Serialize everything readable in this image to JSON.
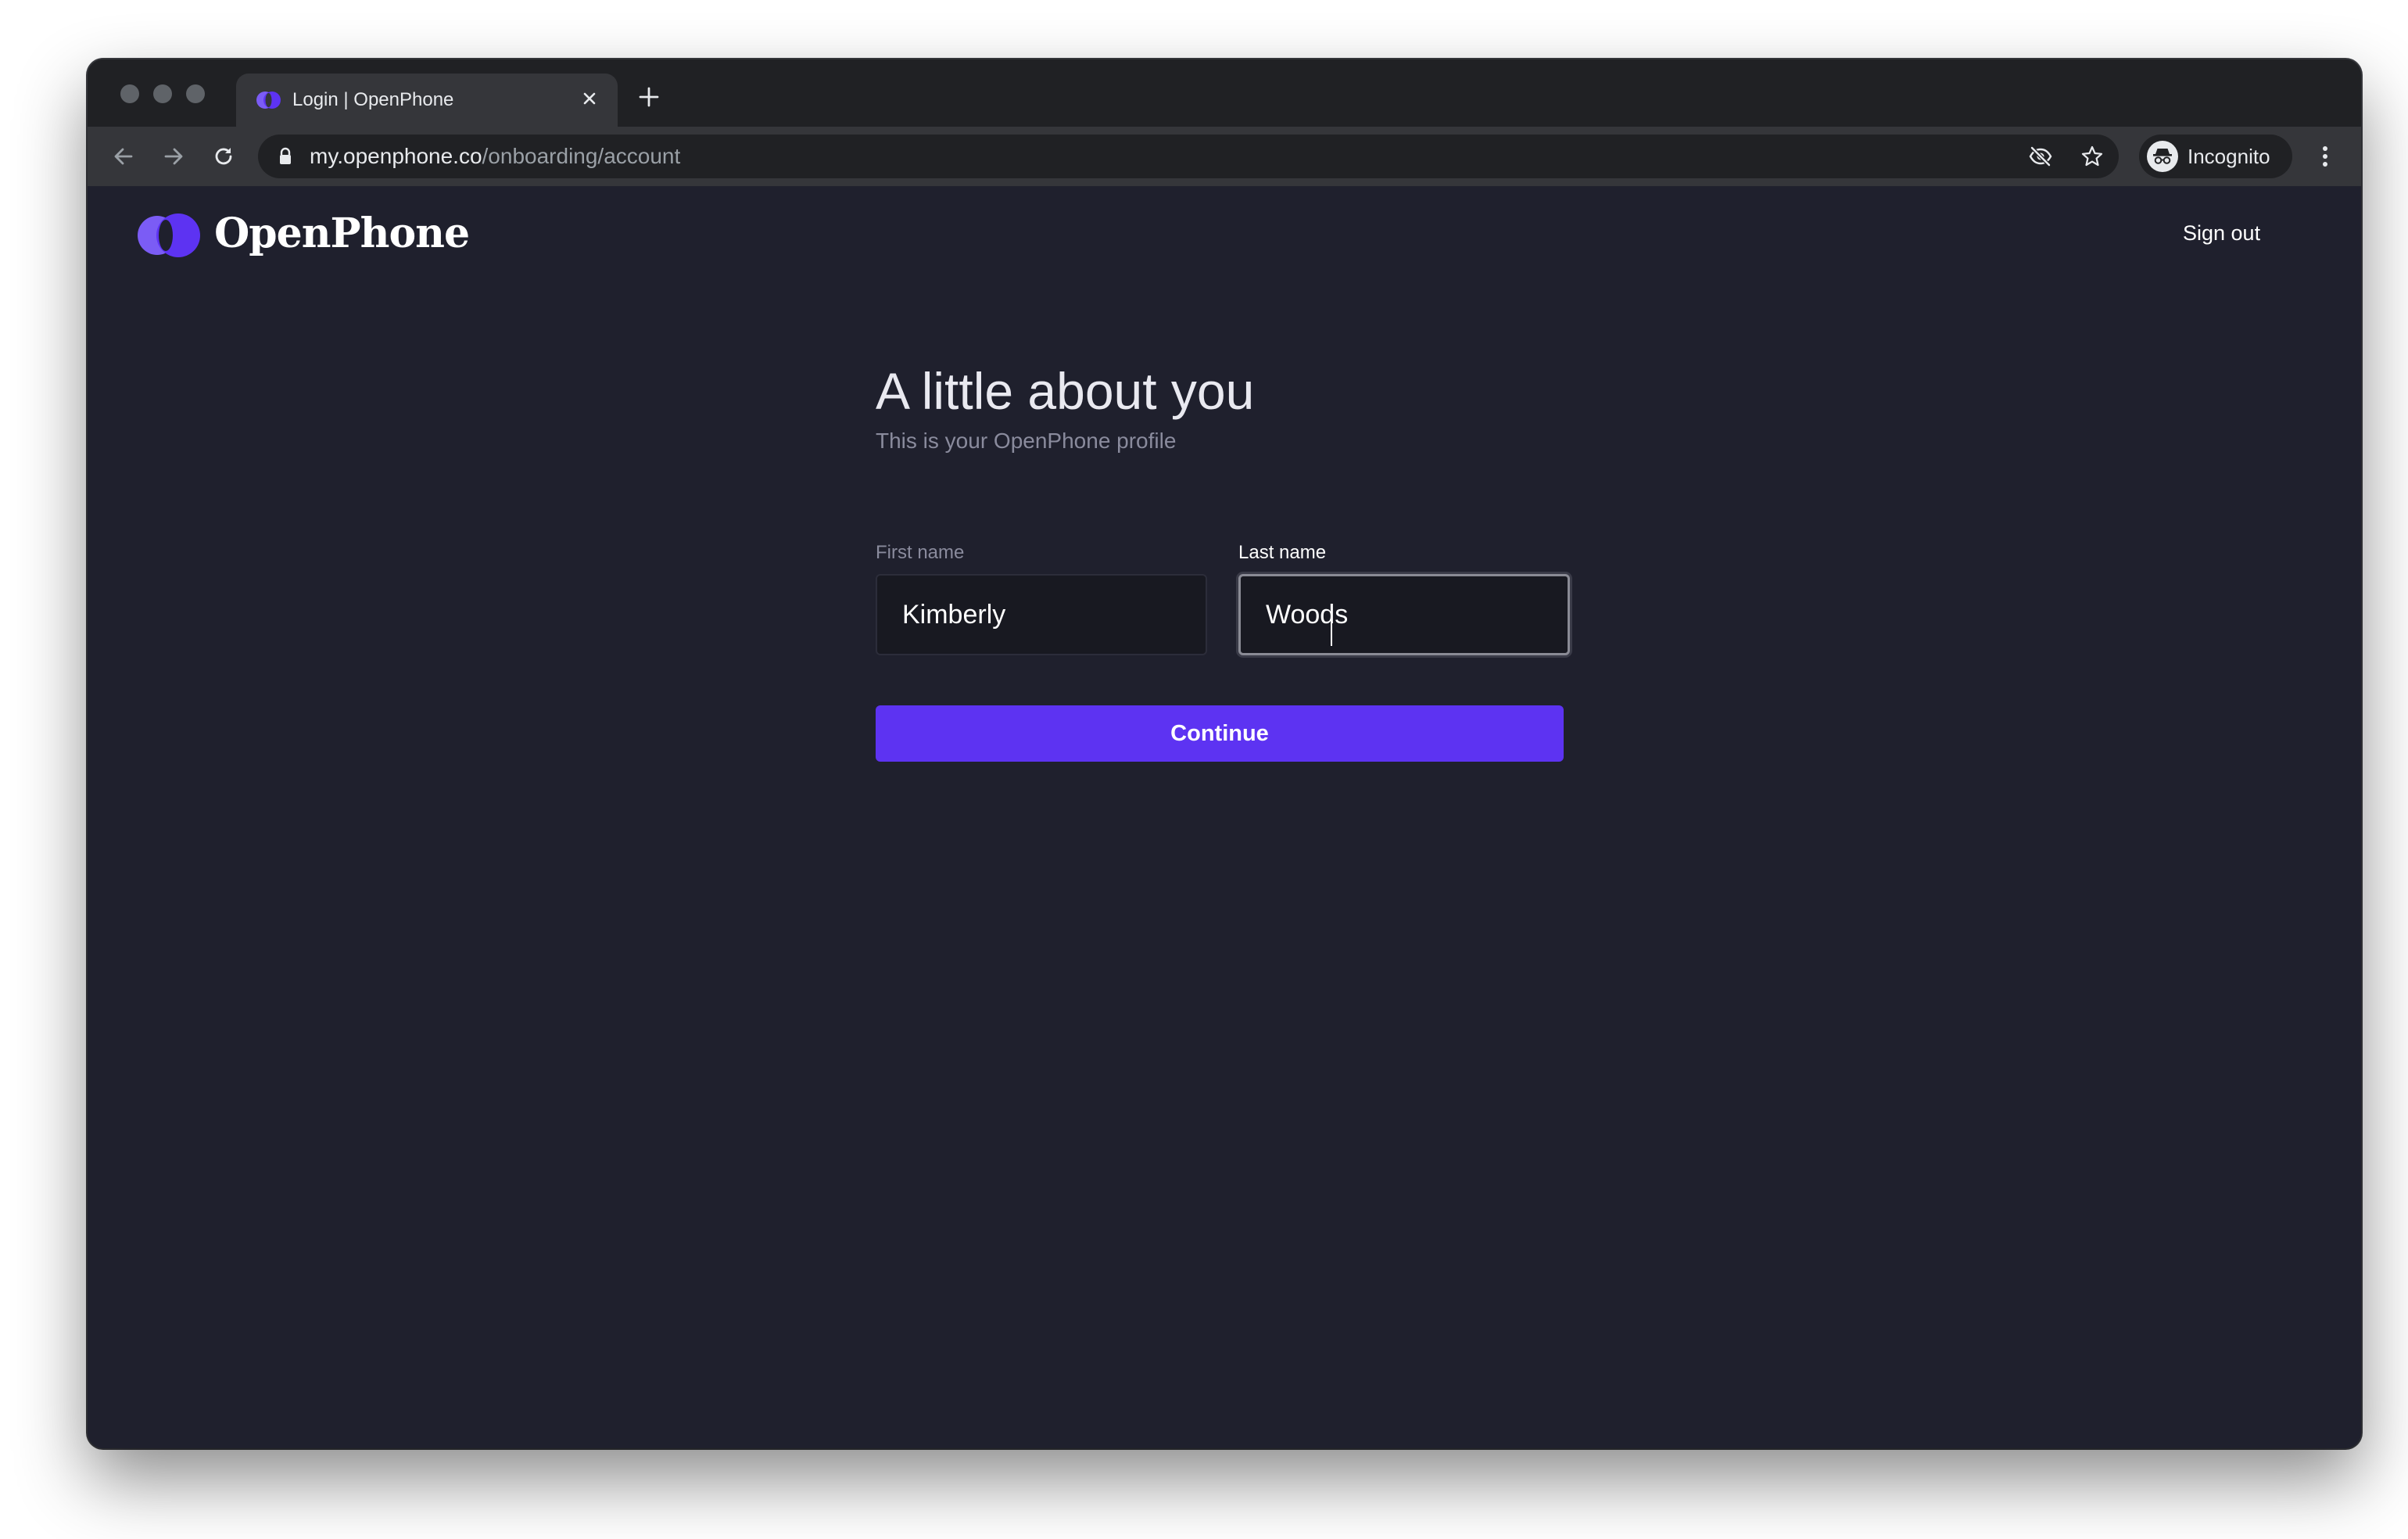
{
  "browser": {
    "tab": {
      "title": "Login | OpenPhone",
      "favicon": "openphone-logo-icon"
    },
    "address": {
      "host": "my.openphone.co",
      "path": "/onboarding/account"
    },
    "profile": {
      "label": "Incognito"
    }
  },
  "app": {
    "logo_text": "OpenPhone",
    "sign_out_label": "Sign out"
  },
  "form": {
    "title": "A little about you",
    "subtitle": "This is your OpenPhone profile",
    "first_name": {
      "label": "First name",
      "value": "Kimberly"
    },
    "last_name": {
      "label": "Last name",
      "value": "Woods"
    },
    "continue_label": "Continue"
  },
  "colors": {
    "brand_accent": "#5d33f2",
    "page_background": "#1f202d",
    "input_background": "#181921"
  }
}
